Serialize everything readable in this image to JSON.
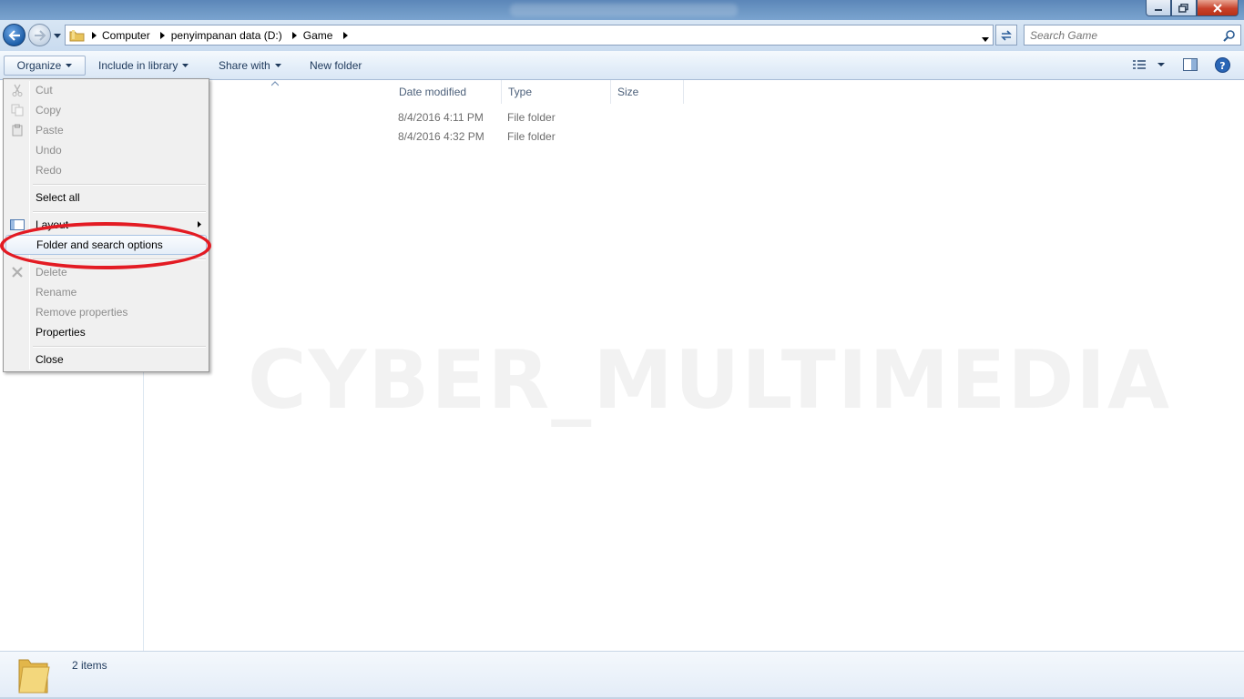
{
  "titlebar": {
    "title": ""
  },
  "address": {
    "crumbs": [
      "Computer",
      "penyimpanan data (D:)",
      "Game"
    ]
  },
  "search": {
    "placeholder": "Search Game"
  },
  "toolbar": {
    "organize": "Organize",
    "include_in_library": "Include in library",
    "share_with": "Share with",
    "new_folder": "New folder"
  },
  "columns": {
    "date_modified": "Date modified",
    "type": "Type",
    "size": "Size"
  },
  "files": [
    {
      "date": "8/4/2016 4:11 PM",
      "type": "File folder",
      "size": ""
    },
    {
      "date": "8/4/2016 4:32 PM",
      "type": "File folder",
      "size": ""
    }
  ],
  "menu": {
    "cut": "Cut",
    "copy": "Copy",
    "paste": "Paste",
    "undo": "Undo",
    "redo": "Redo",
    "select_all": "Select all",
    "layout": "Layout",
    "folder_options": "Folder and search options",
    "delete": "Delete",
    "rename": "Rename",
    "remove_properties": "Remove properties",
    "properties": "Properties",
    "close": "Close"
  },
  "status": {
    "items": "2 items"
  },
  "watermark": "CYBER_MULTIMEDIA",
  "colors": {
    "accent": "#1e395b",
    "highlight_ring": "#e31b23"
  }
}
